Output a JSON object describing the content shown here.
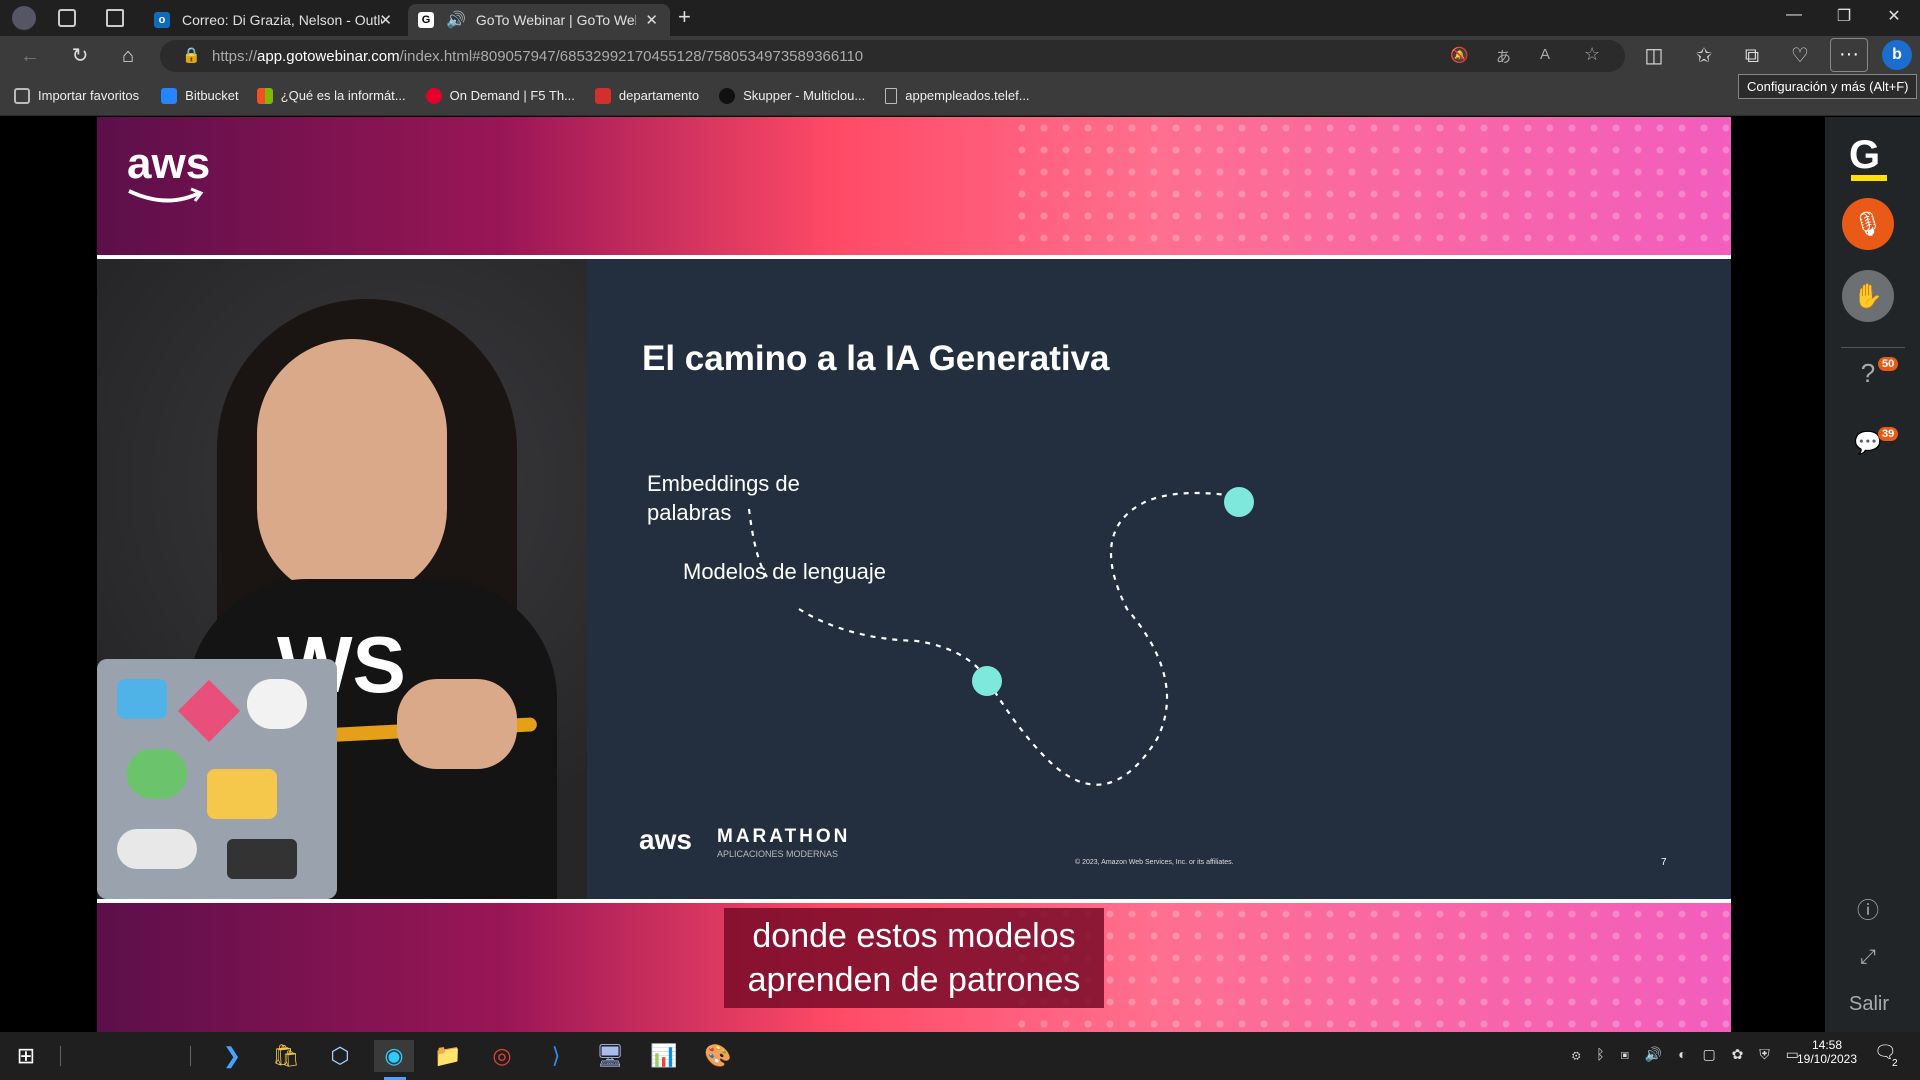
{
  "browser": {
    "tabs": [
      {
        "label": "Correo: Di Grazia, Nelson - Outlo",
        "favicon": "outlook-icon",
        "active": false
      },
      {
        "label": "GoTo Webinar | GoTo Webir",
        "favicon": "goto-icon",
        "active": true
      }
    ],
    "url_prefix": "https://",
    "url_host": "app.gotowebinar.com",
    "url_path": "/index.html#809057947/6853299217045512 8/7580534973589366110",
    "url_full_path": "/index.html#809057947/68532992170455128/7580534973589366110",
    "tooltip": "Configuración y más (Alt+F)"
  },
  "bookmarks": [
    {
      "label": "Importar favoritos",
      "icon": "import-icon",
      "color": "#bbbbbb"
    },
    {
      "label": "Bitbucket",
      "icon": "bitbucket-icon",
      "color": "#2684ff"
    },
    {
      "label": "¿Qué es la informát...",
      "icon": "windows-icon",
      "color": "#f25022"
    },
    {
      "label": "On Demand | F5 Th...",
      "icon": "f5-icon",
      "color": "#e4002b"
    },
    {
      "label": "departamento",
      "icon": "pdf-icon",
      "color": "#d32f2f"
    },
    {
      "label": "Skupper - Multiclou...",
      "icon": "skupper-icon",
      "color": "#333333"
    },
    {
      "label": "appempleados.telef...",
      "icon": "page-icon",
      "color": "#bbbbbb"
    }
  ],
  "slide": {
    "title": "El camino a la IA Generativa",
    "label1_line1": "Embeddings de",
    "label1_line2": "palabras",
    "label2": "Modelos de lenguaje",
    "footer_brand": "MARATHON",
    "footer_sub": "APLICACIONES MODERNAS",
    "copyright": "© 2023, Amazon Web Services, Inc. or its affiliates.",
    "page_number": "7",
    "dot_color": "#7ee8dc",
    "aws_logo": "aws"
  },
  "webcam": {
    "shirt_text": "WS"
  },
  "subtitle": {
    "line1": "donde estos modelos",
    "line2": "aprenden de patrones"
  },
  "goto_panel": {
    "logo": "G",
    "questions_badge": "50",
    "chat_badge": "39",
    "exit_label": "Salir"
  },
  "taskbar": {
    "time": "14:58",
    "date": "19/10/2023",
    "notification_count": "2"
  }
}
